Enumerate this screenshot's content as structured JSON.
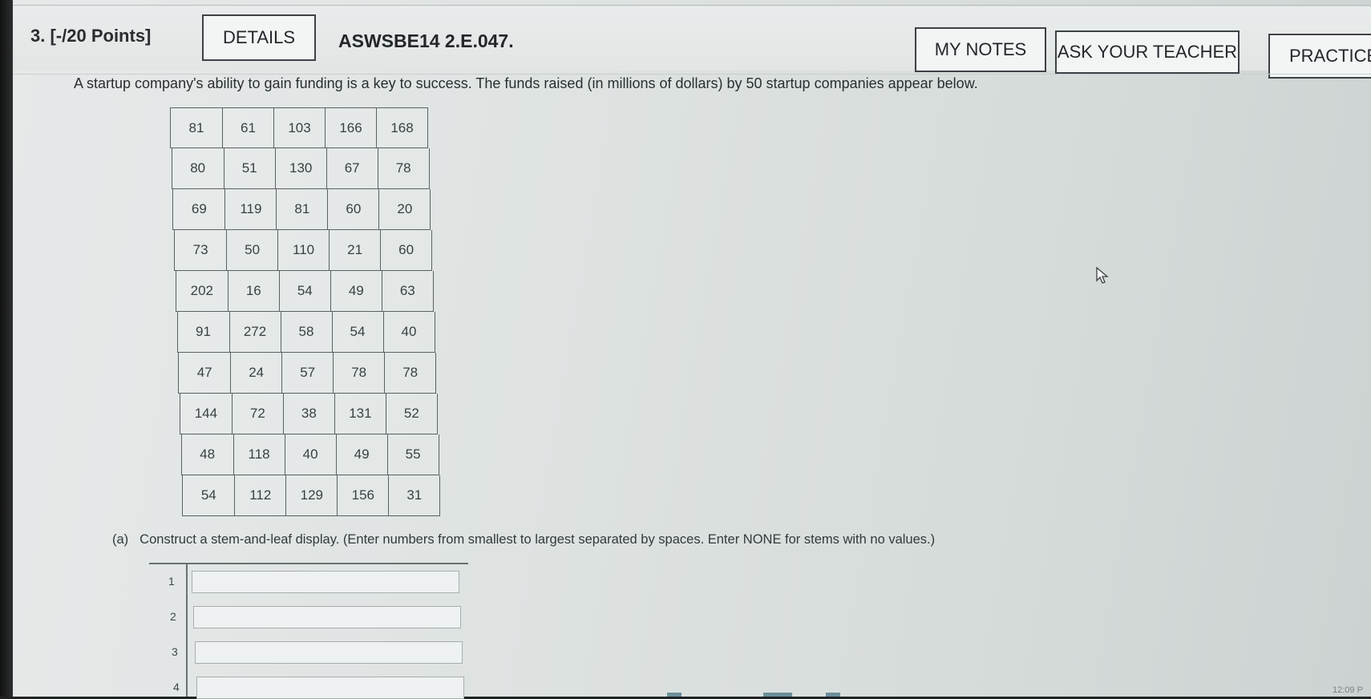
{
  "header": {
    "question_number": "3.",
    "points": "[-/20 Points]",
    "details_label": "DETAILS",
    "problem_code": "ASWSBE14 2.E.047.",
    "my_notes_label": "MY NOTES",
    "ask_teacher_label": "ASK YOUR TEACHER",
    "practice_label": "PRACTICE A"
  },
  "intro_text": "A startup company's ability to gain funding is a key to success. The funds raised (in millions of dollars) by 50 startup companies appear below.",
  "data_table": [
    [
      "81",
      "61",
      "103",
      "166",
      "168"
    ],
    [
      "80",
      "51",
      "130",
      "67",
      "78"
    ],
    [
      "69",
      "119",
      "81",
      "60",
      "20"
    ],
    [
      "73",
      "50",
      "110",
      "21",
      "60"
    ],
    [
      "202",
      "16",
      "54",
      "49",
      "63"
    ],
    [
      "91",
      "272",
      "58",
      "54",
      "40"
    ],
    [
      "47",
      "24",
      "57",
      "78",
      "78"
    ],
    [
      "144",
      "72",
      "38",
      "131",
      "52"
    ],
    [
      "48",
      "118",
      "40",
      "49",
      "55"
    ],
    [
      "54",
      "112",
      "129",
      "156",
      "31"
    ]
  ],
  "part_a": {
    "label": "(a)",
    "instruction": "Construct a stem-and-leaf display. (Enter numbers from smallest to largest separated by spaces. Enter NONE for stems with no values.)",
    "stems": [
      "1",
      "2",
      "3",
      "4"
    ],
    "leaf_values": [
      "",
      "",
      "",
      ""
    ]
  },
  "clock": "12:09 P",
  "icons": {
    "pointer": "mouse-pointer-icon"
  }
}
